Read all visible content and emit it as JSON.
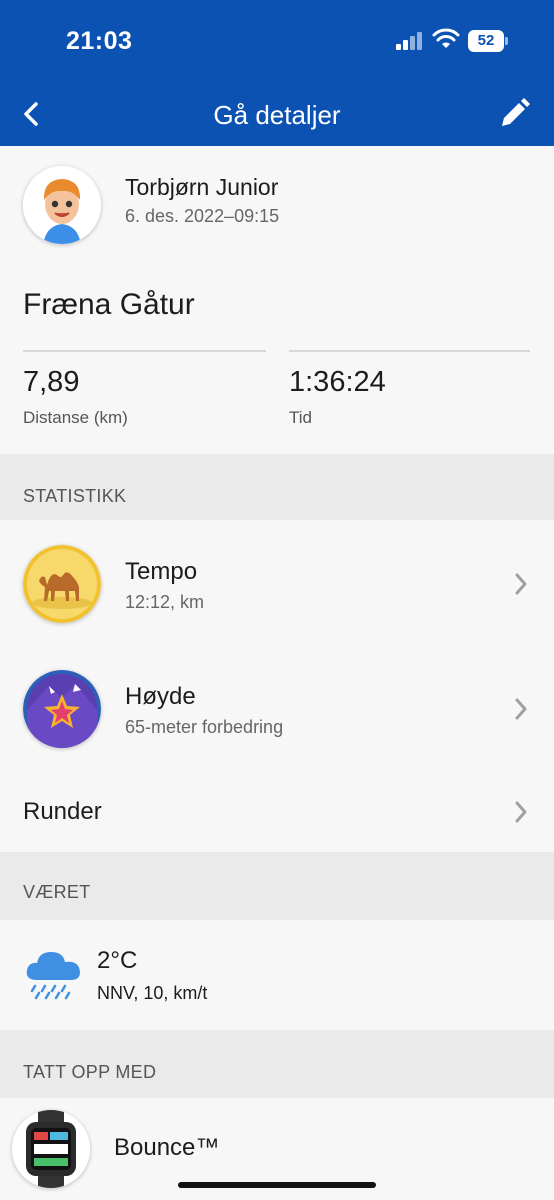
{
  "status": {
    "time": "21:03",
    "battery": "52"
  },
  "nav": {
    "title": "Gå detaljer"
  },
  "profile": {
    "name": "Torbjørn Junior",
    "date": "6. des. 2022–09:15"
  },
  "activity": {
    "title": "Fræna Gåtur"
  },
  "stats": [
    {
      "value": "7,89",
      "label": "Distanse (km)"
    },
    {
      "value": "1:36:24",
      "label": "Tid"
    }
  ],
  "sections": {
    "statistics": "STATISTIKK",
    "weather": "VÆRET",
    "recorded": "TATT OPP MED"
  },
  "statistics_rows": [
    {
      "title": "Tempo",
      "subtitle": "12:12, km"
    },
    {
      "title": "Høyde",
      "subtitle": "65-meter forbedring"
    },
    {
      "title": "Runder"
    }
  ],
  "weather": {
    "temperature": "2°C",
    "wind": "NNV, 10, km/t"
  },
  "device": {
    "name": "Bounce™"
  },
  "colors": {
    "header": "#0c52b3",
    "section_bg": "#eaeaea",
    "background": "#f7f7f7"
  }
}
